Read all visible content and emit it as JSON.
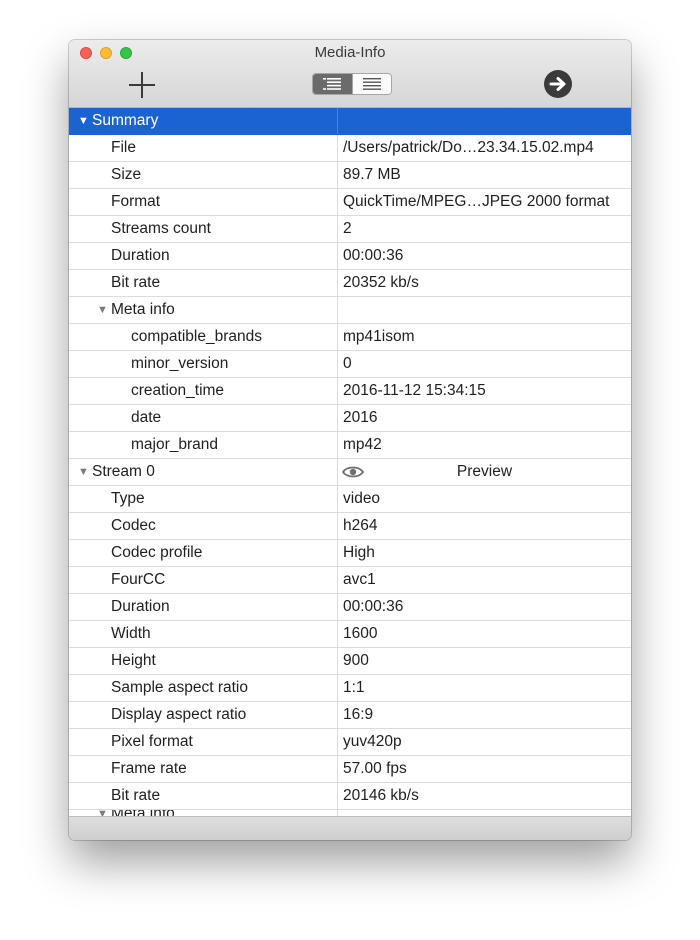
{
  "window": {
    "title": "Media-Info"
  },
  "toolbar": {
    "add_icon": "plus-icon",
    "view_modes": [
      "tree-view",
      "text-view"
    ],
    "go_icon": "arrow-right-circle-icon"
  },
  "colors": {
    "selection": "#1c63d2",
    "grid": "#dcdcdc"
  },
  "rows": [
    {
      "key": "Summary",
      "value": "",
      "level": 0,
      "expandable": true,
      "selected": true
    },
    {
      "key": "File",
      "value": "/Users/patrick/Do…23.34.15.02.mp4",
      "level": 1
    },
    {
      "key": "Size",
      "value": "89.7 MB",
      "level": 1
    },
    {
      "key": "Format",
      "value": "QuickTime/MPEG…JPEG 2000 format",
      "level": 1
    },
    {
      "key": "Streams count",
      "value": "2",
      "level": 1
    },
    {
      "key": "Duration",
      "value": "00:00:36",
      "level": 1
    },
    {
      "key": "Bit rate",
      "value": "20352 kb/s",
      "level": 1
    },
    {
      "key": "Meta info",
      "value": "",
      "level": 1,
      "expandable": true
    },
    {
      "key": "compatible_brands",
      "value": "mp41isom",
      "level": 2
    },
    {
      "key": "minor_version",
      "value": "0",
      "level": 2
    },
    {
      "key": "creation_time",
      "value": "2016-11-12 15:34:15",
      "level": 2
    },
    {
      "key": "date",
      "value": "2016",
      "level": 2
    },
    {
      "key": "major_brand",
      "value": "mp42",
      "level": 2
    },
    {
      "key": "Stream 0",
      "value": "Preview",
      "level": 0,
      "expandable": true,
      "preview": true
    },
    {
      "key": "Type",
      "value": "video",
      "level": 1
    },
    {
      "key": "Codec",
      "value": "h264",
      "level": 1
    },
    {
      "key": "Codec profile",
      "value": "High",
      "level": 1
    },
    {
      "key": "FourCC",
      "value": "avc1",
      "level": 1
    },
    {
      "key": "Duration",
      "value": "00:00:36",
      "level": 1
    },
    {
      "key": "Width",
      "value": "1600",
      "level": 1
    },
    {
      "key": "Height",
      "value": "900",
      "level": 1
    },
    {
      "key": "Sample aspect ratio",
      "value": "1:1",
      "level": 1
    },
    {
      "key": "Display aspect ratio",
      "value": "16:9",
      "level": 1
    },
    {
      "key": "Pixel format",
      "value": "yuv420p",
      "level": 1
    },
    {
      "key": "Frame rate",
      "value": "57.00 fps",
      "level": 1
    },
    {
      "key": "Bit rate",
      "value": "20146 kb/s",
      "level": 1
    },
    {
      "key": "Meta info",
      "value": "",
      "level": 1,
      "expandable": true,
      "partial": true
    }
  ]
}
